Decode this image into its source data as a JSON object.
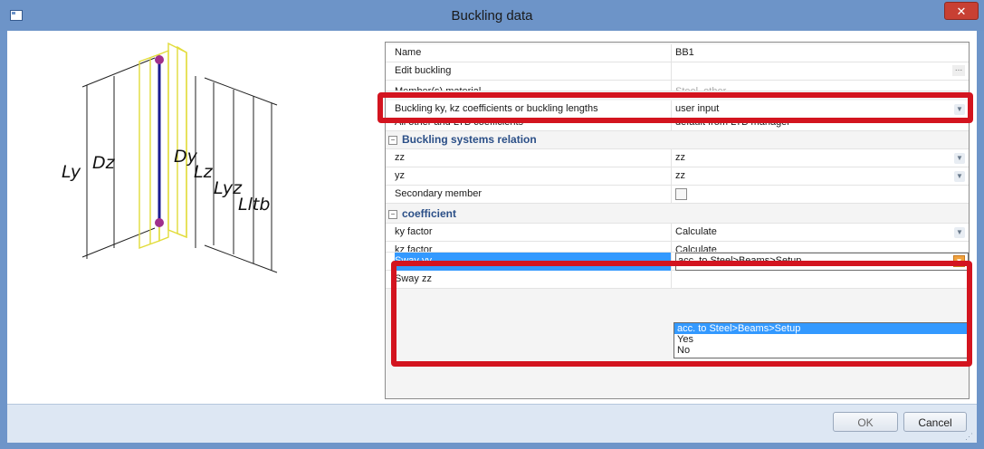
{
  "window": {
    "title": "Buckling data",
    "close_glyph": "✕"
  },
  "diagram": {
    "labels": {
      "ly": "Ly",
      "dz": "Dz",
      "dy": "Dy",
      "lz": "Lz",
      "lyz": "Lyz",
      "lltb": "Lltb"
    },
    "colors": {
      "column_outline": "#e6e04a",
      "member": "#1a1a90",
      "node": "#a0308c"
    }
  },
  "grid": {
    "rows": [
      {
        "id": "name",
        "name": "Name",
        "value": "BB1"
      },
      {
        "id": "edit-buckling",
        "name": "Edit buckling",
        "value": "",
        "button": "..."
      },
      {
        "id": "member-material",
        "name": "Member(s) material",
        "value": "Steel, other"
      },
      {
        "id": "buckling-ky-kz",
        "name": "Buckling ky, kz coefficients or buckling lengths",
        "value": "user input"
      },
      {
        "id": "all-other-ltb",
        "name": "All other and LTB coefficients",
        "value": "default from LTB manager"
      }
    ],
    "group_systems": {
      "title": "Buckling systems relation",
      "collapse": "−"
    },
    "systems_rows": [
      {
        "id": "zz",
        "name": "zz",
        "value": "zz"
      },
      {
        "id": "yz",
        "name": "yz",
        "value": "zz"
      },
      {
        "id": "secondary-member",
        "name": "Secondary member",
        "value": ""
      }
    ],
    "group_coeff": {
      "title": "coefficient",
      "collapse": "−"
    },
    "coeff_rows": [
      {
        "id": "ky-factor",
        "name": "ky factor",
        "value": "Calculate"
      },
      {
        "id": "kz-factor",
        "name": "kz factor",
        "value": "Calculate"
      }
    ],
    "sway_yy": {
      "name": "Sway yy",
      "value": "acc. to Steel>Beams>Setup"
    },
    "sway_zz": {
      "name": "Sway zz"
    },
    "dropdown_options": [
      "acc. to Steel>Beams>Setup",
      "Yes",
      "No"
    ]
  },
  "buttons": {
    "ok": "OK",
    "cancel": "Cancel"
  },
  "accent": {
    "highlight": "#d3141f",
    "selection": "#3399ff"
  }
}
